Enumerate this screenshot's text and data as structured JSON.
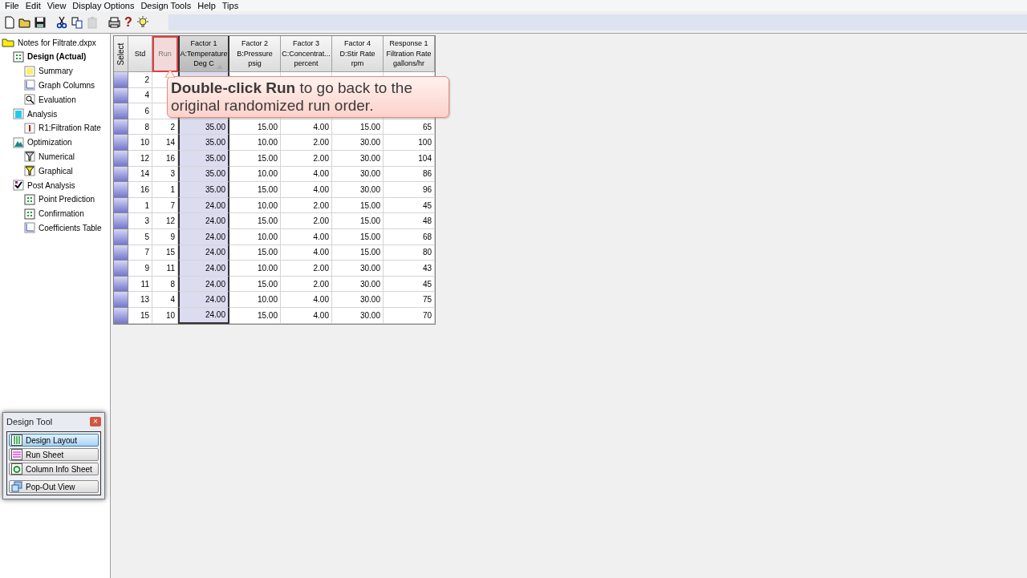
{
  "menu": [
    "File",
    "Edit",
    "View",
    "Display Options",
    "Design Tools",
    "Help",
    "Tips"
  ],
  "toolbar": [
    {
      "kind": "new"
    },
    {
      "kind": "open"
    },
    {
      "kind": "save"
    },
    {
      "kind": "cut"
    },
    {
      "kind": "copy"
    },
    {
      "kind": "paste",
      "disabled": true
    },
    {
      "kind": "print"
    },
    {
      "kind": "help",
      "label": "?"
    },
    {
      "kind": "tip"
    }
  ],
  "tree": {
    "label": "Notes for Filtrate.dxpx",
    "children": [
      {
        "label": "Design (Actual)",
        "selected": true,
        "kind": "grid",
        "children": [
          {
            "label": "Summary",
            "kind": "sheet"
          },
          {
            "label": "Graph Columns",
            "kind": "graph"
          },
          {
            "label": "Evaluation",
            "kind": "magnifier"
          }
        ]
      },
      {
        "label": "Analysis",
        "selected": false,
        "kind": "bars",
        "children": [
          {
            "label": "R1:Filtration Rate",
            "kind": "thermo"
          }
        ]
      },
      {
        "label": "Optimization",
        "selected": false,
        "kind": "mountain",
        "children": [
          {
            "label": "Numerical",
            "kind": "funnel"
          },
          {
            "label": "Graphical",
            "kind": "funnel-y"
          }
        ]
      },
      {
        "label": "Post Analysis",
        "selected": false,
        "kind": "check",
        "children": [
          {
            "label": "Point Prediction",
            "kind": "grid"
          },
          {
            "label": "Confirmation",
            "kind": "grid"
          },
          {
            "label": "Coefficients Table",
            "kind": "graph"
          }
        ]
      }
    ]
  },
  "table": {
    "select_header": "Select",
    "columns": [
      {
        "lines": [
          "Std"
        ],
        "highlighted": false,
        "sorted": false
      },
      {
        "lines": [
          "Run"
        ],
        "highlighted": true,
        "sorted": false
      },
      {
        "lines": [
          "Factor 1",
          "A:Temperature",
          "Deg C"
        ],
        "highlighted": false,
        "sorted": true
      },
      {
        "lines": [
          "Factor 2",
          "B:Pressure",
          "psig"
        ],
        "highlighted": false,
        "sorted": false
      },
      {
        "lines": [
          "Factor 3",
          "C:Concentrat...",
          "percent"
        ],
        "highlighted": false,
        "sorted": false
      },
      {
        "lines": [
          "Factor 4",
          "D:Stir Rate",
          "rpm"
        ],
        "highlighted": false,
        "sorted": false
      },
      {
        "lines": [
          "Response 1",
          "Filtration Rate",
          "gallons/hr"
        ],
        "highlighted": false,
        "sorted": false
      }
    ],
    "rows": [
      {
        "cells": [
          "2"
        ]
      },
      {
        "cells": [
          "4"
        ]
      },
      {
        "cells": [
          "6"
        ]
      },
      {
        "cells": [
          "8",
          "2",
          "35.00",
          "15.00",
          "4.00",
          "15.00",
          "65"
        ]
      },
      {
        "cells": [
          "10",
          "14",
          "35.00",
          "10.00",
          "2.00",
          "30.00",
          "100"
        ]
      },
      {
        "cells": [
          "12",
          "16",
          "35.00",
          "15.00",
          "2.00",
          "30.00",
          "104"
        ]
      },
      {
        "cells": [
          "14",
          "3",
          "35.00",
          "10.00",
          "4.00",
          "30.00",
          "86"
        ]
      },
      {
        "cells": [
          "16",
          "1",
          "35.00",
          "15.00",
          "4.00",
          "30.00",
          "96"
        ]
      },
      {
        "cells": [
          "1",
          "7",
          "24.00",
          "10.00",
          "2.00",
          "15.00",
          "45"
        ]
      },
      {
        "cells": [
          "3",
          "12",
          "24.00",
          "15.00",
          "2.00",
          "15.00",
          "48"
        ]
      },
      {
        "cells": [
          "5",
          "9",
          "24.00",
          "10.00",
          "4.00",
          "15.00",
          "68"
        ]
      },
      {
        "cells": [
          "7",
          "15",
          "24.00",
          "15.00",
          "4.00",
          "15.00",
          "80"
        ]
      },
      {
        "cells": [
          "9",
          "11",
          "24.00",
          "10.00",
          "2.00",
          "30.00",
          "43"
        ]
      },
      {
        "cells": [
          "11",
          "8",
          "24.00",
          "15.00",
          "2.00",
          "30.00",
          "45"
        ]
      },
      {
        "cells": [
          "13",
          "4",
          "24.00",
          "10.00",
          "4.00",
          "30.00",
          "75"
        ]
      },
      {
        "cells": [
          "15",
          "10",
          "24.00",
          "15.00",
          "4.00",
          "30.00",
          "70"
        ]
      }
    ]
  },
  "callout": {
    "text": "**Double-click Run** to go back to the original randomized run order."
  },
  "design_tool": {
    "title": "Design Tool",
    "close": "×",
    "buttons": [
      {
        "label": "Design Layout",
        "kind": "columns",
        "selected": true
      },
      {
        "label": "Run Sheet",
        "kind": "rows",
        "selected": false
      },
      {
        "label": "Column Info Sheet",
        "kind": "cycle",
        "selected": false
      },
      {
        "label": "Pop-Out View",
        "kind": "windows",
        "selected": false
      }
    ]
  }
}
